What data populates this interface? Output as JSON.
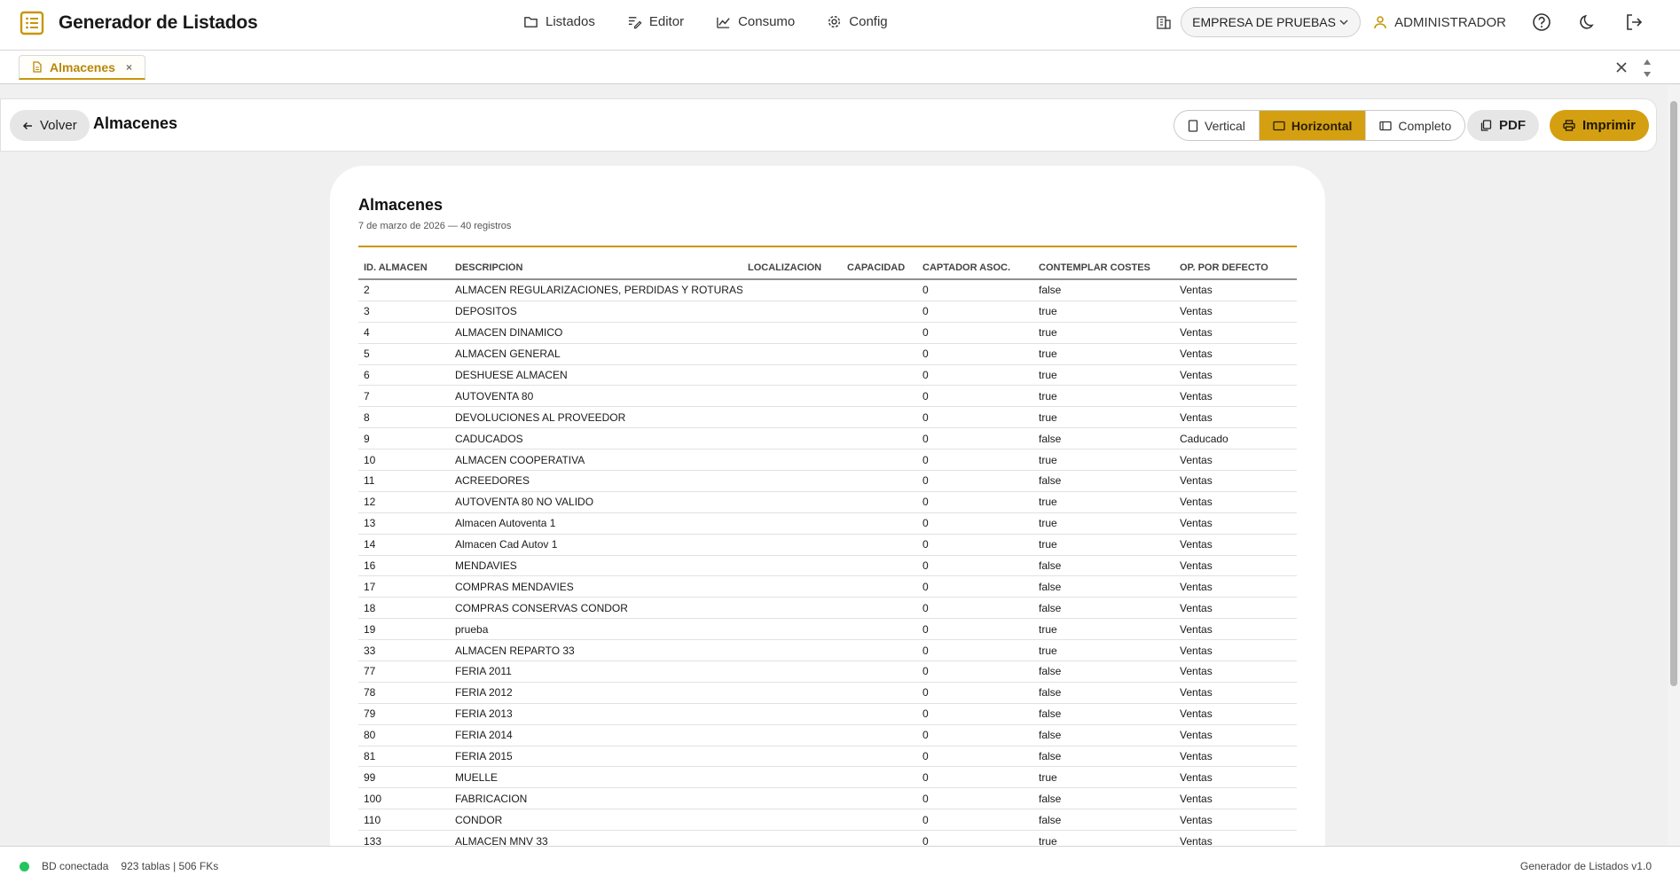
{
  "app": {
    "title": "Generador de Listados"
  },
  "nav": [
    {
      "label": "Listados",
      "icon": "folder-icon"
    },
    {
      "label": "Editor",
      "icon": "edit-icon"
    },
    {
      "label": "Consumo",
      "icon": "chart-icon"
    },
    {
      "label": "Config",
      "icon": "gear-icon"
    }
  ],
  "header": {
    "company": "EMPRESA DE PRUEBAS",
    "user": "ADMINISTRADOR"
  },
  "tabs": [
    {
      "label": "Almacenes",
      "close": "×"
    }
  ],
  "toolbar": {
    "back_label": "Volver",
    "title": "Almacenes",
    "views": [
      "Vertical",
      "Horizontal",
      "Completo"
    ],
    "active_view": "Horizontal",
    "pdf_label": "PDF",
    "print_label": "Imprimir"
  },
  "report": {
    "title": "Almacenes",
    "subtitle": "7 de marzo de 2026 — 40 registros",
    "columns": [
      "ID. ALMACEN",
      "DESCRIPCIÓN",
      "LOCALIZACIÓN",
      "CAPACIDAD",
      "CAPTADOR ASOC.",
      "CONTEMPLAR COSTES",
      "OP. POR DEFECTO"
    ],
    "rows": [
      [
        "2",
        "ALMACEN REGULARIZACIONES, PERDIDAS Y ROTURAS",
        "",
        "",
        "0",
        "false",
        "Ventas"
      ],
      [
        "3",
        "DEPOSITOS",
        "",
        "",
        "0",
        "true",
        "Ventas"
      ],
      [
        "4",
        "ALMACEN DINAMICO",
        "",
        "",
        "0",
        "true",
        "Ventas"
      ],
      [
        "5",
        "ALMACEN GENERAL",
        "",
        "",
        "0",
        "true",
        "Ventas"
      ],
      [
        "6",
        "DESHUESE ALMACEN",
        "",
        "",
        "0",
        "true",
        "Ventas"
      ],
      [
        "7",
        "AUTOVENTA 80",
        "",
        "",
        "0",
        "true",
        "Ventas"
      ],
      [
        "8",
        "DEVOLUCIONES AL PROVEEDOR",
        "",
        "",
        "0",
        "true",
        "Ventas"
      ],
      [
        "9",
        "CADUCADOS",
        "",
        "",
        "0",
        "false",
        "Caducado"
      ],
      [
        "10",
        "ALMACEN COOPERATIVA",
        "",
        "",
        "0",
        "true",
        "Ventas"
      ],
      [
        "11",
        "ACREEDORES",
        "",
        "",
        "0",
        "false",
        "Ventas"
      ],
      [
        "12",
        "AUTOVENTA 80 NO VALIDO",
        "",
        "",
        "0",
        "true",
        "Ventas"
      ],
      [
        "13",
        "Almacen Autoventa 1",
        "",
        "",
        "0",
        "true",
        "Ventas"
      ],
      [
        "14",
        "Almacen Cad Autov 1",
        "",
        "",
        "0",
        "true",
        "Ventas"
      ],
      [
        "16",
        "MENDAVIES",
        "",
        "",
        "0",
        "false",
        "Ventas"
      ],
      [
        "17",
        "COMPRAS MENDAVIES",
        "",
        "",
        "0",
        "false",
        "Ventas"
      ],
      [
        "18",
        "COMPRAS CONSERVAS CONDOR",
        "",
        "",
        "0",
        "false",
        "Ventas"
      ],
      [
        "19",
        "prueba",
        "",
        "",
        "0",
        "true",
        "Ventas"
      ],
      [
        "33",
        "ALMACEN REPARTO 33",
        "",
        "",
        "0",
        "true",
        "Ventas"
      ],
      [
        "77",
        "FERIA 2011",
        "",
        "",
        "0",
        "false",
        "Ventas"
      ],
      [
        "78",
        "FERIA 2012",
        "",
        "",
        "0",
        "false",
        "Ventas"
      ],
      [
        "79",
        "FERIA 2013",
        "",
        "",
        "0",
        "false",
        "Ventas"
      ],
      [
        "80",
        "FERIA 2014",
        "",
        "",
        "0",
        "false",
        "Ventas"
      ],
      [
        "81",
        "FERIA 2015",
        "",
        "",
        "0",
        "false",
        "Ventas"
      ],
      [
        "99",
        "MUELLE",
        "",
        "",
        "0",
        "true",
        "Ventas"
      ],
      [
        "100",
        "FABRICACION",
        "",
        "",
        "0",
        "false",
        "Ventas"
      ],
      [
        "110",
        "CONDOR",
        "",
        "",
        "0",
        "false",
        "Ventas"
      ],
      [
        "133",
        "ALMACEN MNV 33",
        "",
        "",
        "0",
        "true",
        "Ventas"
      ]
    ]
  },
  "status": {
    "connection": "BD conectada",
    "stats": "923 tablas | 506 FKs",
    "version": "Generador de Listados v1.0"
  },
  "colors": {
    "accent": "#d4a012",
    "tab_text": "#b8860b",
    "status_ok": "#22c55e"
  }
}
